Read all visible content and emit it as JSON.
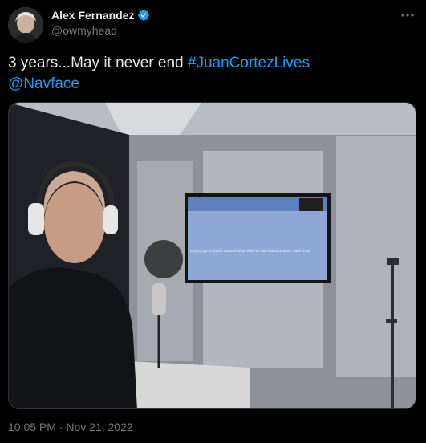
{
  "author": {
    "display_name": "Alex Fernandez",
    "handle": "@owmyhead",
    "verified": true
  },
  "tweet": {
    "text_plain": "3 years...May it never end ",
    "hashtag": "#JuanCortezLives",
    "mention": "@Navface"
  },
  "media": {
    "tv_screen_caption": "Enemy spy activated Sonar Sweep. Wish we had that back when I was RGB"
  },
  "timestamp": "10:05 PM · Nov 21, 2022",
  "icons": {
    "more": "more-horizontal-icon",
    "verified": "verified-badge-icon"
  },
  "colors": {
    "background": "#000000",
    "text": "#e7e9ea",
    "secondary": "#71767b",
    "link": "#1d9bf0"
  }
}
